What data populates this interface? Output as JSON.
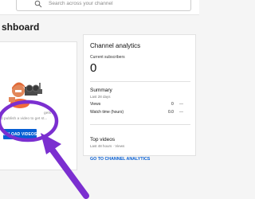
{
  "search": {
    "placeholder": "Search across your channel",
    "icon": "search-icon"
  },
  "page": {
    "title": "shboard"
  },
  "left_card": {
    "hint_line1": "gets?",
    "hint_line2": "d publish a video to get st...",
    "upload_button": "UPLOAD VIDEOS"
  },
  "analytics": {
    "title": "Channel analytics",
    "current_subscribers_label": "Current subscribers",
    "current_subscribers_value": "0",
    "summary_title": "Summary",
    "summary_period": "Last 28 days",
    "rows": [
      {
        "label": "Views",
        "value": "0",
        "trend": "—"
      },
      {
        "label": "Watch time (hours)",
        "value": "0.0",
        "trend": "—"
      }
    ],
    "top_videos_title": "Top videos",
    "top_videos_period": "Last 48 hours · Views",
    "link": "GO TO CHANNEL ANALYTICS"
  },
  "colors": {
    "accent": "#065fd4",
    "highlight_annotation": "#7b2fd0"
  }
}
